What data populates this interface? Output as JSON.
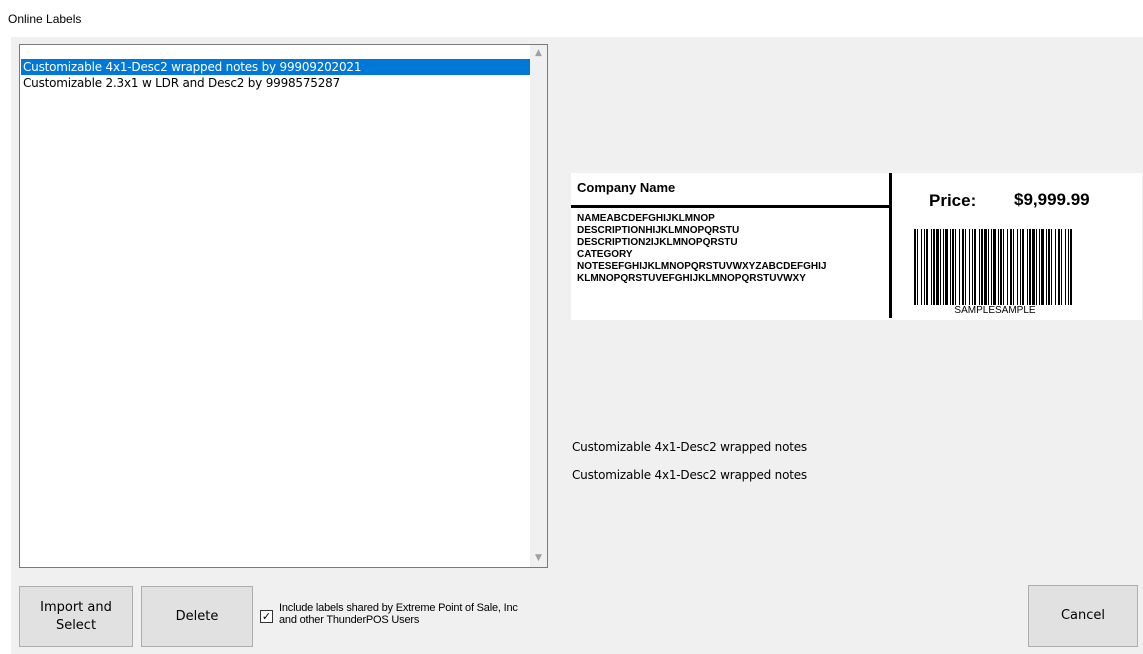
{
  "window": {
    "title": "Online Labels"
  },
  "label_list": {
    "items": [
      {
        "label": "Customizable 4x1-Desc2 wrapped notes by 99909202021",
        "selected": true
      },
      {
        "label": "Customizable 2.3x1 w LDR and Desc2 by 9998575287",
        "selected": false
      }
    ]
  },
  "preview": {
    "company": "Company Name",
    "lines": [
      "NAMEABCDEFGHIJKLMNOP",
      "DESCRIPTIONHIJKLMNOPQRSTU",
      "DESCRIPTION2IJKLMNOPQRSTU",
      "CATEGORY",
      "NOTESEFGHIJKLMNOPQRSTUVWXYZABCDEFGHIJ",
      "KLMNOPQRSTUVEFGHIJKLMNOPQRSTUVWXY"
    ],
    "price_label": "Price:",
    "price_value": "$9,999.99",
    "barcode_text": "SAMPLESAMPLE"
  },
  "description": {
    "line1": "Customizable 4x1-Desc2 wrapped notes",
    "line2": "Customizable 4x1-Desc2 wrapped notes"
  },
  "buttons": {
    "import_line1": "Import and",
    "import_line2": "Select",
    "delete": "Delete",
    "cancel": "Cancel"
  },
  "shared_checkbox": {
    "checked": true,
    "label": "Include labels shared by Extreme Point of Sale, Inc and other ThunderPOS Users"
  },
  "icons": {
    "check": "✓",
    "scroll_up": "▲",
    "scroll_down": "▼"
  },
  "colors": {
    "selection": "#0078d7",
    "panel": "#f0f0f0",
    "button": "#e1e1e1"
  }
}
